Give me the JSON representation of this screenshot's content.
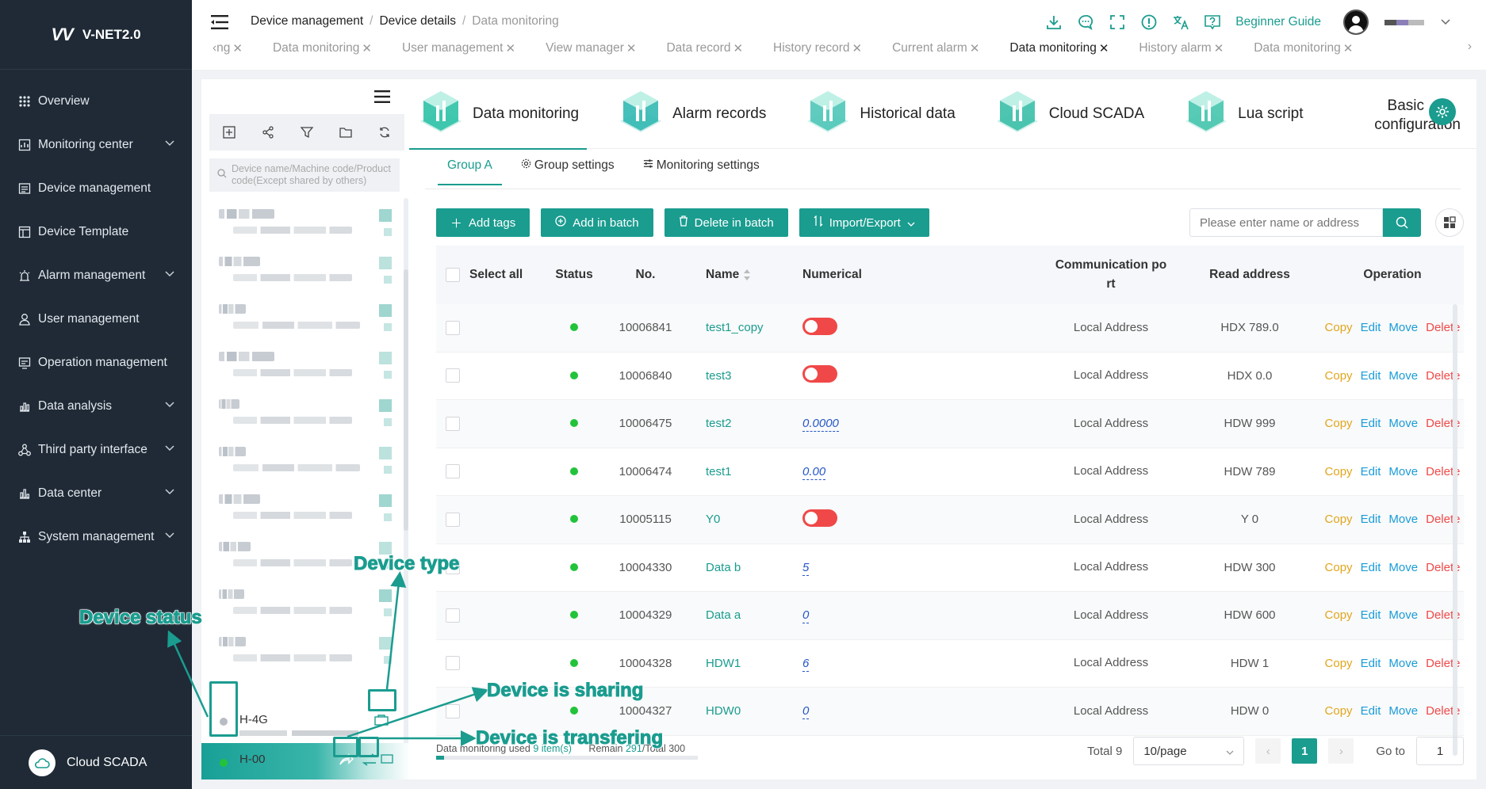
{
  "brand": {
    "logo": "VV",
    "name": "V-NET2.0"
  },
  "sidebar": {
    "items": [
      {
        "label": "Overview",
        "icon": "grid-icon",
        "expandable": false
      },
      {
        "label": "Monitoring center",
        "icon": "monitor-icon",
        "expandable": true
      },
      {
        "label": "Device management",
        "icon": "device-icon",
        "expandable": false
      },
      {
        "label": "Device Template",
        "icon": "template-icon",
        "expandable": false
      },
      {
        "label": "Alarm management",
        "icon": "alarm-icon",
        "expandable": true
      },
      {
        "label": "User management",
        "icon": "user-icon",
        "expandable": false
      },
      {
        "label": "Operation management",
        "icon": "operation-icon",
        "expandable": false
      },
      {
        "label": "Data analysis",
        "icon": "chart-icon",
        "expandable": true
      },
      {
        "label": "Third party interface",
        "icon": "interface-icon",
        "expandable": true
      },
      {
        "label": "Data center",
        "icon": "database-icon",
        "expandable": true
      },
      {
        "label": "System management",
        "icon": "system-icon",
        "expandable": true
      }
    ],
    "bottom": {
      "label": "Cloud SCADA",
      "icon": "cloud-icon"
    }
  },
  "header": {
    "breadcrumb": [
      "Device management",
      "Device details",
      "Data monitoring"
    ],
    "separator": "/",
    "guide": "Beginner Guide",
    "tabs": [
      {
        "label": "‹ng",
        "active": false
      },
      {
        "label": "Data monitoring",
        "active": false
      },
      {
        "label": "User management",
        "active": false
      },
      {
        "label": "View manager",
        "active": false
      },
      {
        "label": "Data record",
        "active": false
      },
      {
        "label": "History record",
        "active": false
      },
      {
        "label": "Current alarm",
        "active": false
      },
      {
        "label": "Data monitoring",
        "active": true
      },
      {
        "label": "History alarm",
        "active": false
      },
      {
        "label": "Data monitoring",
        "active": false
      }
    ],
    "tab_close": "✕",
    "tab_more": "›"
  },
  "device_panel": {
    "search_placeholder": "Device name/Machine code/Product code(Except shared by others)",
    "devices": [
      {
        "name": "H-4G",
        "status": "offline",
        "status_color": "#b8bdc4"
      },
      {
        "name": "H-00",
        "status": "online",
        "status_color": "#22c33a"
      }
    ]
  },
  "apps": [
    {
      "label": "Data monitoring",
      "active": true
    },
    {
      "label": "Alarm records",
      "active": false
    },
    {
      "label": "Historical data",
      "active": false
    },
    {
      "label": "Cloud SCADA",
      "active": false
    },
    {
      "label": "Lua script",
      "active": false
    }
  ],
  "basic_config": {
    "line1": "Basic",
    "line2": "configuration"
  },
  "subtabs": [
    {
      "label": "Group A",
      "active": true
    },
    {
      "label": "Group settings",
      "icon": "gear-icon"
    },
    {
      "label": "Monitoring settings",
      "icon": "sliders-icon"
    }
  ],
  "toolbar": {
    "add_tags": "Add tags",
    "add_batch": "Add in batch",
    "delete_batch": "Delete in batch",
    "import_export": "Import/Export",
    "search_placeholder": "Please enter name or address"
  },
  "table": {
    "headers": {
      "select_all": "Select all",
      "status": "Status",
      "no": "No.",
      "name": "Name",
      "numerical": "Numerical",
      "comm_port": "Communication port",
      "read_address": "Read address",
      "operation": "Operation"
    },
    "ops": {
      "copy": "Copy",
      "edit": "Edit",
      "move": "Move",
      "delete": "Delete"
    },
    "rows": [
      {
        "no": "10006841",
        "name": "test1_copy",
        "value_type": "switch",
        "value": "",
        "port": "Local Address",
        "address": "HDX 789.0"
      },
      {
        "no": "10006840",
        "name": "test3",
        "value_type": "switch",
        "value": "",
        "port": "Local Address",
        "address": "HDX 0.0"
      },
      {
        "no": "10006475",
        "name": "test2",
        "value_type": "number",
        "value": "0.0000",
        "port": "Local Address",
        "address": "HDW 999"
      },
      {
        "no": "10006474",
        "name": "test1",
        "value_type": "number",
        "value": "0.00",
        "port": "Local Address",
        "address": "HDW 789"
      },
      {
        "no": "10005115",
        "name": "Y0",
        "value_type": "switch",
        "value": "",
        "port": "Local Address",
        "address": "Y 0"
      },
      {
        "no": "10004330",
        "name": "Data b",
        "value_type": "number",
        "value": "5",
        "port": "Local Address",
        "address": "HDW 300"
      },
      {
        "no": "10004329",
        "name": "Data a",
        "value_type": "number",
        "value": "0",
        "port": "Local Address",
        "address": "HDW 600"
      },
      {
        "no": "10004328",
        "name": "HDW1",
        "value_type": "number",
        "value": "6",
        "port": "Local Address",
        "address": "HDW 1"
      },
      {
        "no": "10004327",
        "name": "HDW0",
        "value_type": "number",
        "value": "0",
        "port": "Local Address",
        "address": "HDW 0"
      }
    ]
  },
  "usage": {
    "prefix": "Data monitoring used",
    "used": "9 item(s)",
    "remain_label": "Remain",
    "remain": "291",
    "total_label": "/Total 300",
    "fraction": 0.03
  },
  "pagination": {
    "total": "Total 9",
    "page_size": "10/page",
    "current": "1",
    "goto_label": "Go to",
    "goto_value": "1",
    "prev": "‹",
    "next": "›"
  },
  "annotations": {
    "device_status": "Device status",
    "device_type": "Device type",
    "device_sharing": "Device is sharing",
    "device_transfering": "Device is transfering"
  },
  "colors": {
    "primary": "#1a9c8f",
    "sidebar": "#1f2a36",
    "danger": "#f04848",
    "online": "#22c33a",
    "copy": "#e0a61d",
    "link": "#1a9cd8"
  }
}
